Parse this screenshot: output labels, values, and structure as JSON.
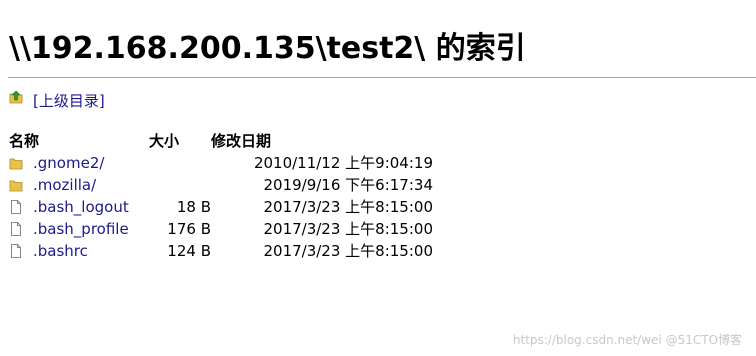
{
  "header": {
    "title": "\\\\192.168.200.135\\test2\\ 的索引"
  },
  "parent": {
    "label": "[上级目录]",
    "icon": "folder-up-icon"
  },
  "table": {
    "columns": {
      "name": "名称",
      "size": "大小",
      "modified": "修改日期"
    },
    "rows": [
      {
        "icon": "folder-icon",
        "name": ".gnome2/",
        "size": "",
        "modified": "2010/11/12 上午9:04:19"
      },
      {
        "icon": "folder-icon",
        "name": ".mozilla/",
        "size": "",
        "modified": "2019/9/16 下午6:17:34"
      },
      {
        "icon": "file-icon",
        "name": ".bash_logout",
        "size": "18 B",
        "modified": "2017/3/23 上午8:15:00"
      },
      {
        "icon": "file-icon",
        "name": ".bash_profile",
        "size": "176 B",
        "modified": "2017/3/23 上午8:15:00"
      },
      {
        "icon": "file-icon",
        "name": ".bashrc",
        "size": "124 B",
        "modified": "2017/3/23 上午8:15:00"
      }
    ]
  },
  "watermark": "https://blog.csdn.net/wei @51CTO博客",
  "colors": {
    "link": "#1a1a8c",
    "folder": "#e8c24a",
    "up_arrow": "#3a9a2a"
  }
}
